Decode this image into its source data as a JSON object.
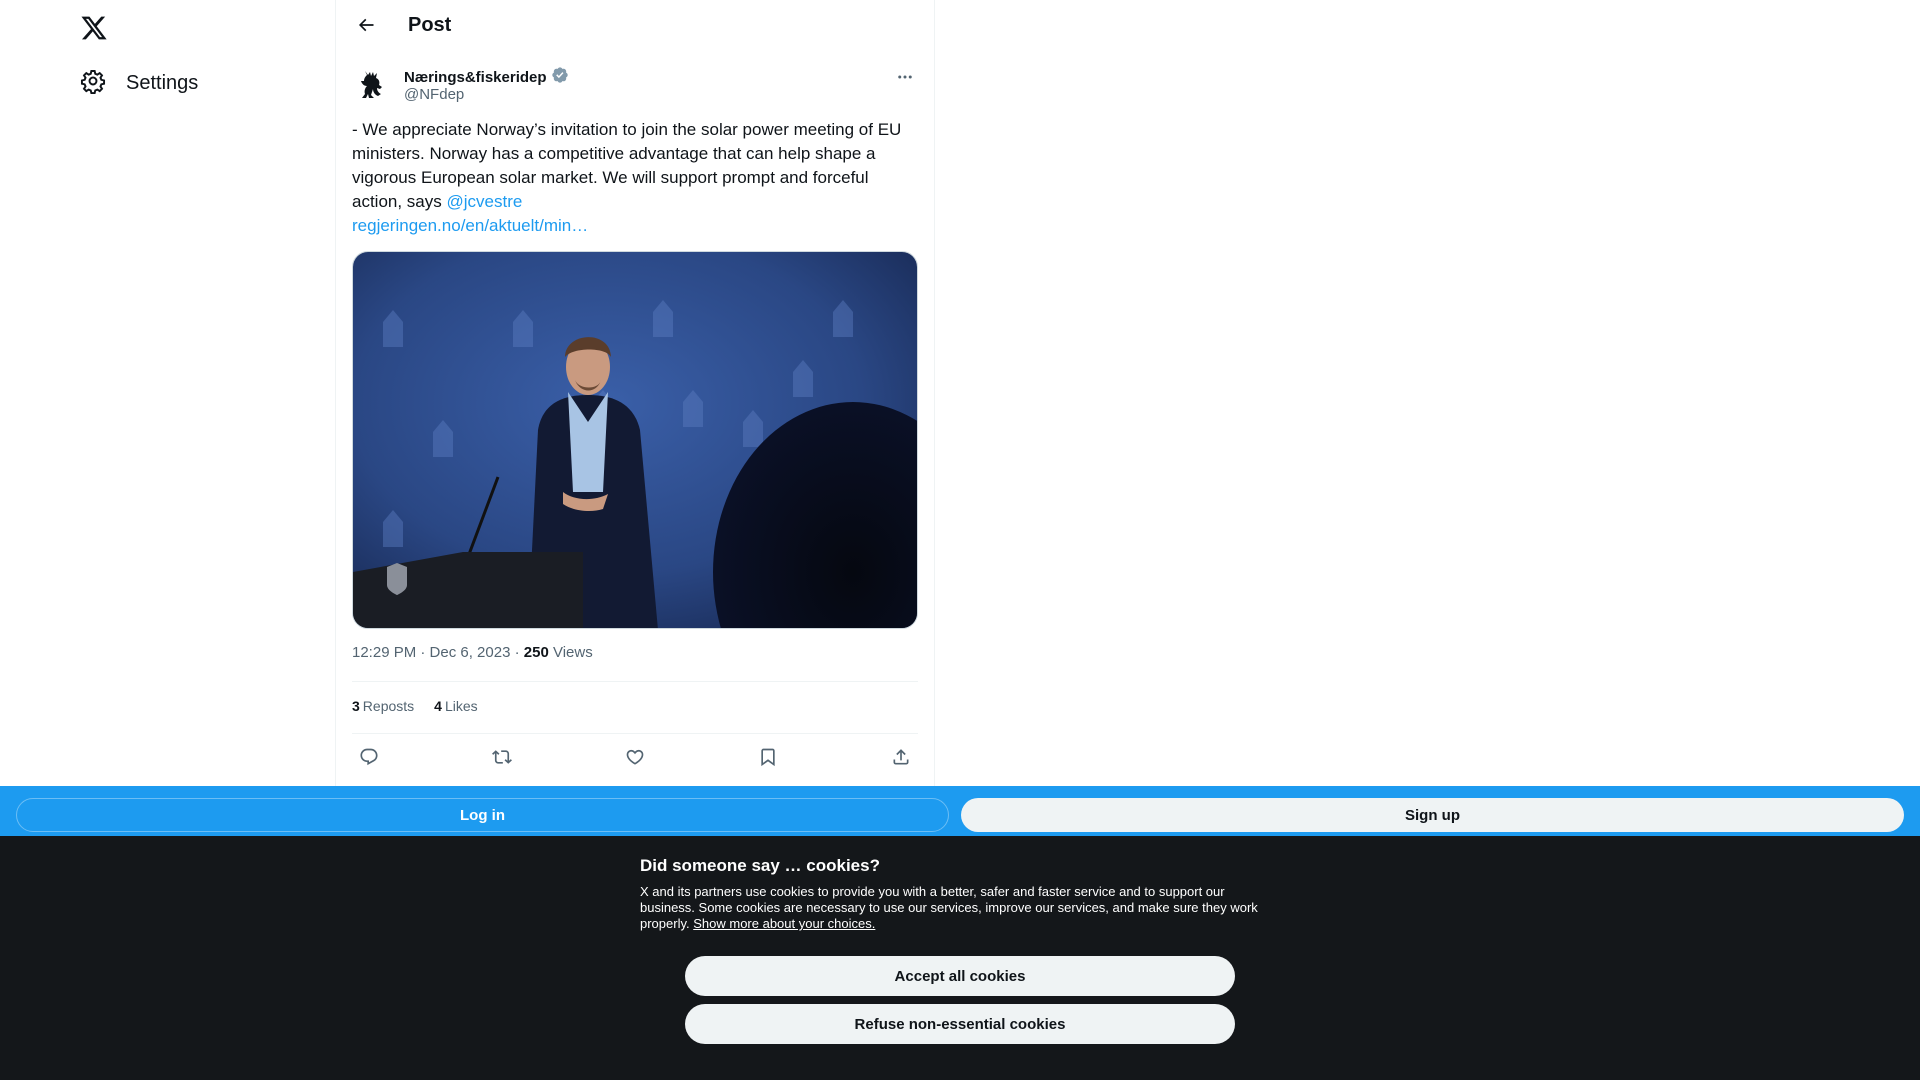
{
  "nav": {
    "logo_icon": "x-logo-icon",
    "settings_label": "Settings"
  },
  "header": {
    "title": "Post"
  },
  "author": {
    "name": "Nærings&fiskeridep",
    "handle": "@NFdep",
    "verified": true,
    "verified_color": "#829aab"
  },
  "tweet": {
    "text": "- We appreciate Norway’s invitation to join the solar power meeting of EU ministers. Norway has a competitive advantage that can help shape a vigorous European solar market. We will support prompt and forceful action, says ",
    "mention": "@jcvestre",
    "link": "regjeringen.no/en/aktuelt/min…",
    "time": "12:29 PM · Dec 6, 2023 · ",
    "views_count": "250",
    "views_label": " Views"
  },
  "stats": {
    "reposts_count": "3",
    "reposts_label": "Reposts",
    "likes_count": "4",
    "likes_label": "Likes"
  },
  "actions": [
    "reply-icon",
    "repost-icon",
    "like-icon",
    "bookmark-icon",
    "share-icon"
  ],
  "login_bar": {
    "login_label": "Log in",
    "signup_label": "Sign up",
    "bar_color": "#1d9bf0"
  },
  "cookie": {
    "title": "Did someone say … cookies?",
    "body": "X and its partners use cookies to provide you with a better, safer and faster service and to support our business. Some cookies are necessary to use our services, improve our services, and make sure they work properly. ",
    "more_link": "Show more about your choices.",
    "accept_label": "Accept all cookies",
    "refuse_label": "Refuse non-essential cookies"
  },
  "colors": {
    "accent": "#1d9bf0",
    "text_primary": "#0f1419",
    "text_secondary": "#536471",
    "cookie_bg": "#14171a"
  }
}
